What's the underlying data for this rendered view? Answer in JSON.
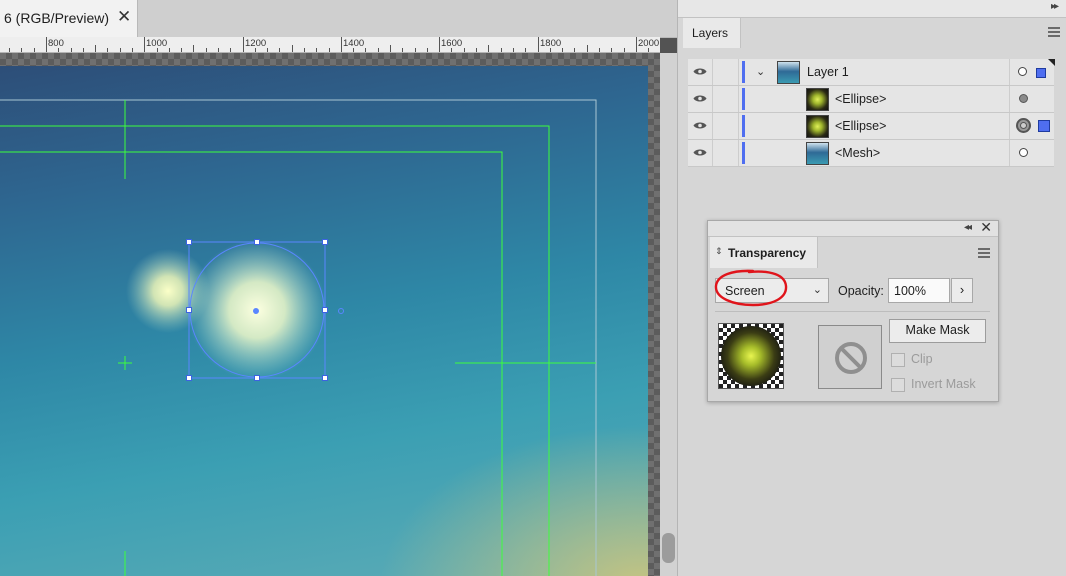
{
  "document": {
    "tab_title": "6 (RGB/Preview)",
    "close_glyph": "✕",
    "ruler_labels": [
      "800",
      "1000",
      "1200",
      "1400",
      "1600",
      "1800",
      "2000"
    ]
  },
  "dock": {
    "collapse_glyph": "▸▸"
  },
  "layers_panel": {
    "tab_label": "Layers",
    "rows": [
      {
        "name": "Layer 1",
        "thumb": "mesh",
        "expanded": true
      },
      {
        "name": "<Ellipse>",
        "thumb": "ellipse"
      },
      {
        "name": "<Ellipse>",
        "thumb": "ellipse",
        "targeted": true,
        "selected": true
      },
      {
        "name": "<Mesh>",
        "thumb": "mesh"
      }
    ],
    "selection_color": "#4f6ef0"
  },
  "transparency_panel": {
    "collapse_glyph": "◂◂",
    "close_glyph": "✕",
    "tab_updown_glyph": "⌃⌄",
    "tab_label": "Transparency",
    "blend_mode": "Screen",
    "opacity_label": "Opacity:",
    "opacity_value": "100%",
    "opacity_arrow": "›",
    "make_mask_label": "Make Mask",
    "clip_label": "Clip",
    "invert_mask_label": "Invert Mask",
    "annotation_color": "#e0141b"
  }
}
